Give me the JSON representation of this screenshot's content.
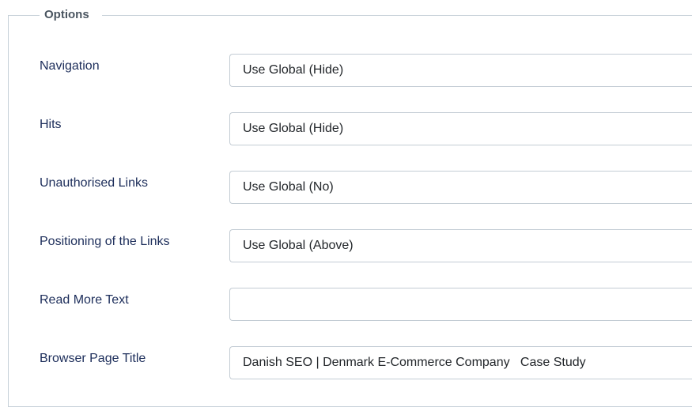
{
  "fieldset": {
    "legend": "Options"
  },
  "fields": [
    {
      "label": "Navigation",
      "value": "Use Global (Hide)"
    },
    {
      "label": "Hits",
      "value": "Use Global (Hide)"
    },
    {
      "label": "Unauthorised Links",
      "value": "Use Global (No)"
    },
    {
      "label": "Positioning of the Links",
      "value": "Use Global (Above)"
    },
    {
      "label": "Read More Text",
      "value": ""
    },
    {
      "label": "Browser Page Title",
      "value": "Danish SEO | Denmark E-Commerce Company   Case Study"
    }
  ]
}
